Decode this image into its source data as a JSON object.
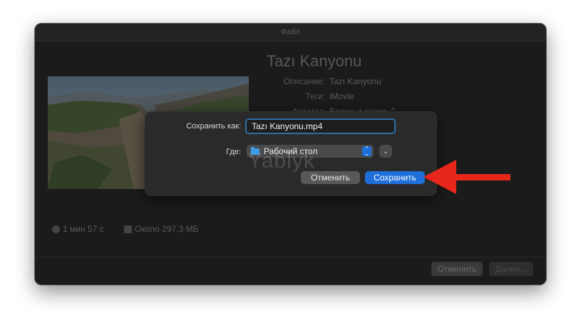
{
  "window": {
    "title": "Файл",
    "video_title": "Tazı Kanyonu",
    "meta": [
      {
        "label": "Описание:",
        "value": "Tazı Kanyonu"
      },
      {
        "label": "Теги:",
        "value": "iMovie"
      },
      {
        "label": "Формат:",
        "value": "Видео и аудио"
      }
    ],
    "stats": {
      "duration": "1 мин 57 с",
      "size": "Около 297,3 МБ"
    },
    "cancel_label": "Отменить",
    "next_label": "Далее..."
  },
  "save_sheet": {
    "save_as_label": "Сохранить как:",
    "filename": "Tazı Kanyonu.mp4",
    "where_label": "Где:",
    "where_value": "Рабочий стол",
    "cancel_label": "Отменить",
    "save_label": "Сохранить"
  },
  "watermark": "Yablyk",
  "colors": {
    "accent": "#1f6fdb",
    "arrow": "#e8271c"
  }
}
